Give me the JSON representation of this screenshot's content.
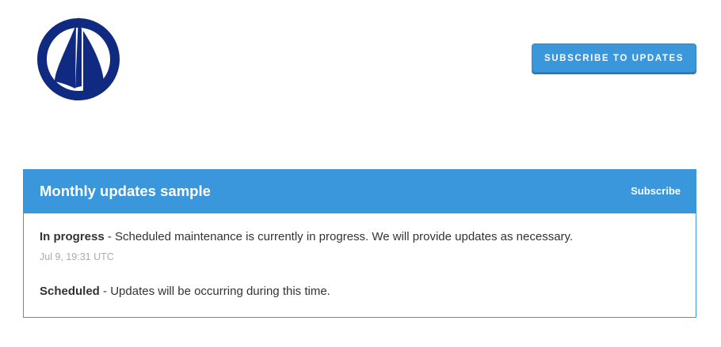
{
  "header": {
    "subscribe_button_label": "SUBSCRIBE TO UPDATES",
    "logo_icon": "sailboat-logo-icon"
  },
  "incident": {
    "title": "Monthly updates sample",
    "subscribe_link": "Subscribe",
    "updates": [
      {
        "status": "In progress",
        "separator": " - ",
        "message": "Scheduled maintenance is currently in progress. We will provide updates as necessary.",
        "timestamp": "Jul 9, 19:31 UTC"
      },
      {
        "status": "Scheduled",
        "separator": " - ",
        "message": "Updates will be occurring during this time."
      }
    ]
  },
  "colors": {
    "accent": "#3a97db",
    "logo_navy": "#0f2a80",
    "text": "#333333",
    "muted": "#aaaaaa"
  }
}
